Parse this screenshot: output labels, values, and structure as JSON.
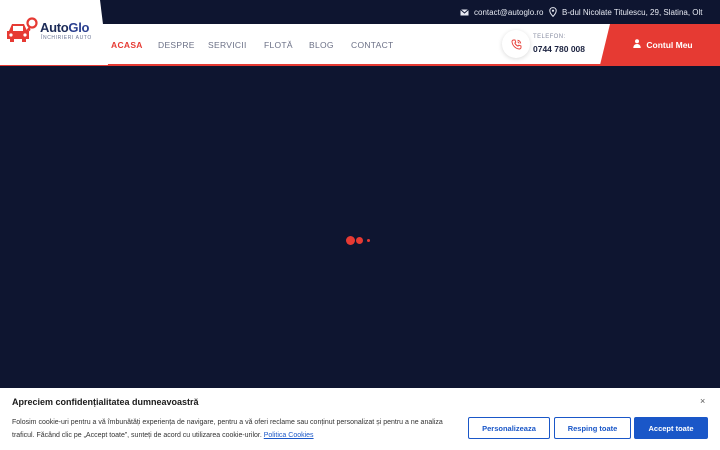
{
  "topbar": {
    "email": "contact@autoglo.ro",
    "address": "B-dul Nicolate Titulescu, 29, Slatina, Olt"
  },
  "logo": {
    "name_part1": "Auto",
    "name_part2": "Glo",
    "tagline": "ÎNCHIRIERI AUTO"
  },
  "nav": {
    "items": [
      {
        "label": "ACASA",
        "active": true
      },
      {
        "label": "DESPRE"
      },
      {
        "label": "SERVICII"
      },
      {
        "label": "FLOTĂ"
      },
      {
        "label": "BLOG"
      },
      {
        "label": "CONTACT"
      }
    ]
  },
  "phone": {
    "label": "TELEFON:",
    "number": "0744 780 008"
  },
  "account": {
    "label": "Contul Meu"
  },
  "cookie": {
    "title": "Apreciem confidențialitatea dumneavoastră",
    "text": "Folosim cookie-uri pentru a vă îmbunătăți experiența de navigare, pentru a vă oferi reclame sau conținut personalizat și pentru a ne analiza traficul. Făcând clic pe „Accept toate”, sunteți de acord cu utilizarea cookie-urilor.",
    "policy_link": "Politica Cookies",
    "close": "×",
    "customize_label": "Personalizeaza",
    "reject_label": "Resping toate",
    "accept_label": "Accept toate"
  },
  "colors": {
    "accent": "#e63a33",
    "navy": "#0e1530",
    "cookie_blue": "#1a57c8"
  }
}
